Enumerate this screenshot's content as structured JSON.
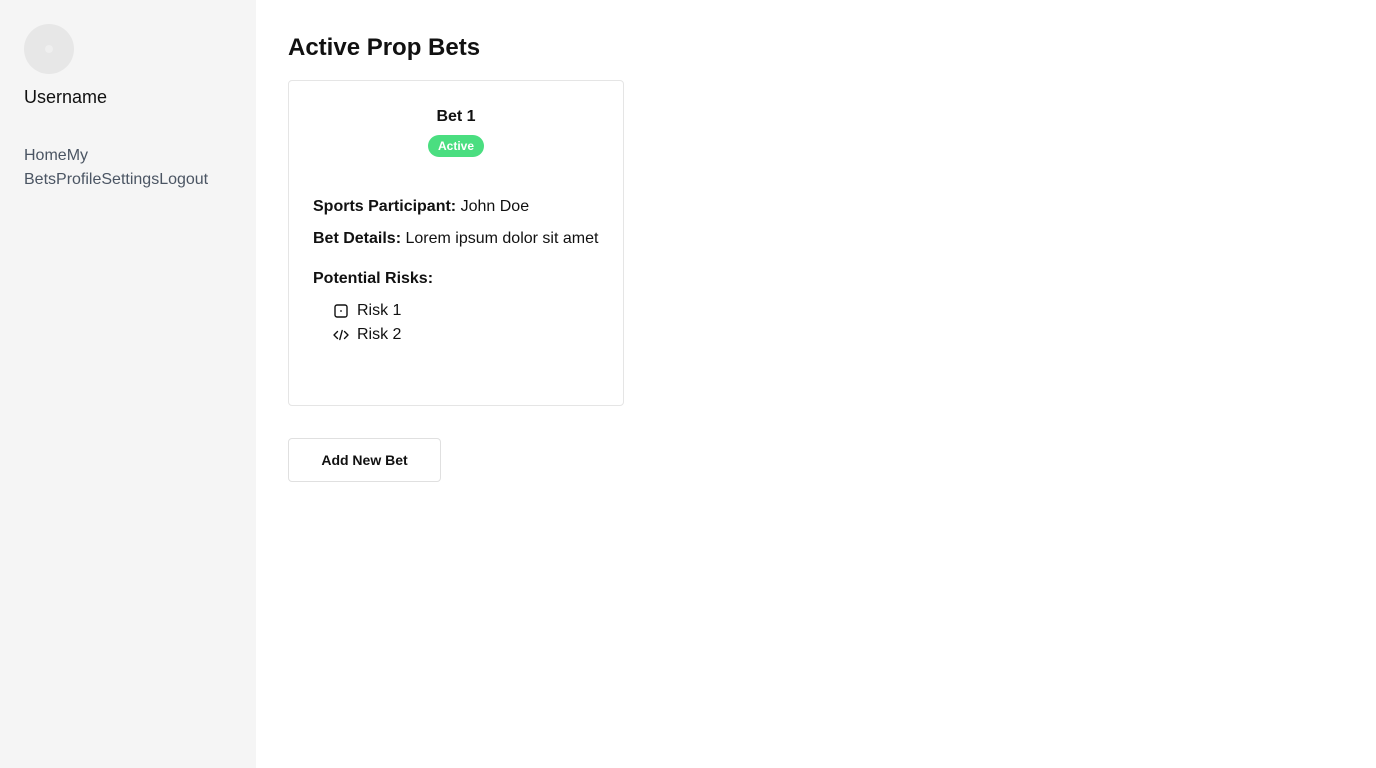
{
  "sidebar": {
    "username": "Username",
    "nav": [
      "Home",
      "My Bets",
      "Profile",
      "Settings",
      "Logout"
    ]
  },
  "main": {
    "title": "Active Prop Bets",
    "bet": {
      "title": "Bet 1",
      "status": "Active",
      "participant_label": "Sports Participant:",
      "participant": "John Doe",
      "details_label": "Bet Details:",
      "details": "Lorem ipsum dolor sit amet",
      "risks_label": "Potential Risks:",
      "risks": [
        {
          "icon": "square-icon",
          "label": "Risk 1"
        },
        {
          "icon": "code-icon",
          "label": "Risk 2"
        }
      ]
    },
    "add_button": "Add New Bet"
  },
  "colors": {
    "sidebar_bg": "#f5f5f5",
    "badge": "#4ade80",
    "nav_text": "#4b5563"
  }
}
